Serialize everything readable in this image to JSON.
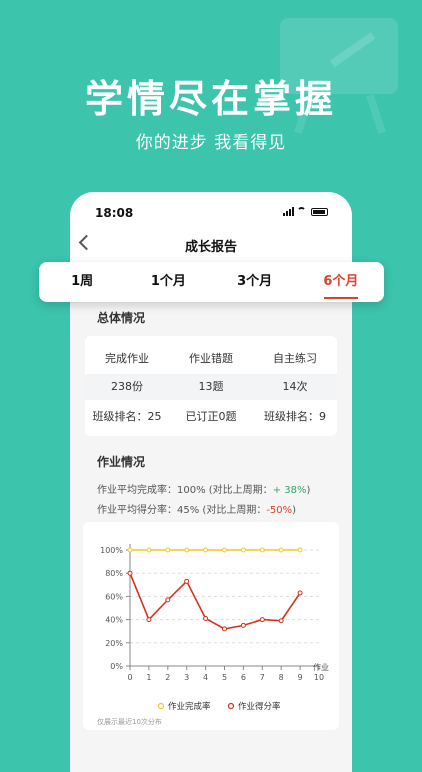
{
  "hero": {
    "title": "学情尽在掌握",
    "subtitle": "你的进步  我看得见"
  },
  "status_bar": {
    "time": "18:08"
  },
  "nav": {
    "title": "成长报告"
  },
  "tabs": [
    {
      "label": "1周",
      "active": false
    },
    {
      "label": "1个月",
      "active": false
    },
    {
      "label": "3个月",
      "active": false
    },
    {
      "label": "6个月",
      "active": true
    }
  ],
  "overview": {
    "title": "总体情况",
    "headers": [
      "完成作业",
      "作业错题",
      "自主练习"
    ],
    "values": [
      "238份",
      "13题",
      "14次"
    ],
    "extras": [
      "班级排名：25",
      "已订正0题",
      "班级排名：9"
    ]
  },
  "homework": {
    "title": "作业情况",
    "completion": {
      "label": "作业平均完成率：",
      "value": "100%",
      "compare": "(对比上周期：",
      "delta": "+ 38%",
      "close": ")"
    },
    "score": {
      "label": "作业平均得分率：",
      "value": "45%",
      "compare": "(对比上周期：",
      "delta": "-50%",
      "close": ")"
    }
  },
  "chart_data": {
    "type": "line",
    "x": [
      0,
      1,
      2,
      3,
      4,
      5,
      6,
      7,
      8,
      9
    ],
    "x_ticks": [
      "0",
      "1",
      "2",
      "3",
      "4",
      "5",
      "6",
      "7",
      "8",
      "9",
      "10"
    ],
    "y_ticks": [
      "0%",
      "20%",
      "40%",
      "60%",
      "80%",
      "100%"
    ],
    "xlim": [
      0,
      10
    ],
    "ylim": [
      0,
      100
    ],
    "xlabel": "作业",
    "ylabel": "",
    "grid": true,
    "legend_position": "bottom",
    "series": [
      {
        "name": "作业完成率",
        "color": "#f2c72b",
        "values": [
          100,
          100,
          100,
          100,
          100,
          100,
          100,
          100,
          100,
          100
        ]
      },
      {
        "name": "作业得分率",
        "color": "#d2331f",
        "values": [
          80,
          40,
          57,
          73,
          41,
          32,
          35,
          40,
          39,
          63
        ]
      }
    ],
    "note": "仅展示最近10次分布"
  }
}
